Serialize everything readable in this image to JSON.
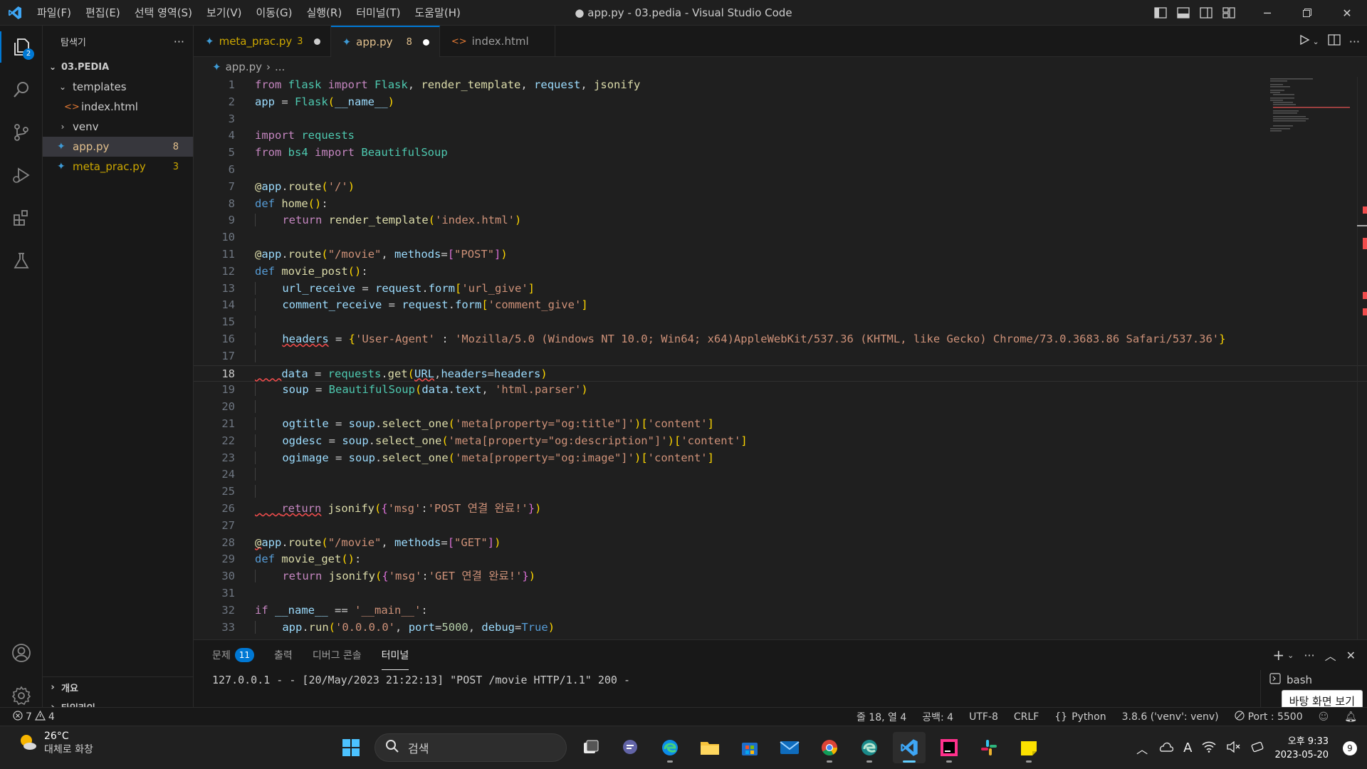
{
  "titlebar": {
    "menu": [
      "파일(F)",
      "편집(E)",
      "선택 영역(S)",
      "보기(V)",
      "이동(G)",
      "실행(R)",
      "터미널(T)",
      "도움말(H)"
    ],
    "title": "● app.py - 03.pedia - Visual Studio Code"
  },
  "activitybar": {
    "explorer_badge": "2"
  },
  "sidebar": {
    "title": "탐색기",
    "more": "···",
    "root": "03.PEDIA",
    "items": [
      {
        "label": "templates",
        "type": "folder-open"
      },
      {
        "label": "index.html",
        "type": "html"
      },
      {
        "label": "venv",
        "type": "folder"
      },
      {
        "label": "app.py",
        "type": "python",
        "count": "8"
      },
      {
        "label": "meta_prac.py",
        "type": "python",
        "count": "3"
      }
    ],
    "outline": "개요",
    "timeline": "타임라인"
  },
  "tabs": [
    {
      "label": "meta_prac.py",
      "count": "3"
    },
    {
      "label": "app.py",
      "count": "8"
    },
    {
      "label": "index.html",
      "count": ""
    }
  ],
  "breadcrumb": {
    "file": "app.py",
    "rest": "..."
  },
  "code": {
    "line_numbers": [
      "1",
      "2",
      "3",
      "4",
      "5",
      "6",
      "7",
      "8",
      "9",
      "10",
      "11",
      "12",
      "13",
      "14",
      "15",
      "16",
      "17",
      "18",
      "19",
      "20",
      "21",
      "22",
      "23",
      "24",
      "25",
      "26",
      "27",
      "28",
      "29",
      "30",
      "31",
      "32",
      "33"
    ],
    "current_line": "18"
  },
  "panel": {
    "tabs": [
      "문제",
      "출력",
      "디버그 콘솔",
      "터미널"
    ],
    "problems_count": "11",
    "terminal_output": "127.0.0.1 - - [20/May/2023 21:22:13] \"POST /movie HTTP/1.1\" 200 -",
    "terminal_name": "bash",
    "tooltip": "바탕 화면 보기"
  },
  "statusbar": {
    "errors": "7",
    "warnings": "4",
    "position": "줄 18, 열 4",
    "spaces": "공백: 4",
    "encoding": "UTF-8",
    "eol": "CRLF",
    "language": "Python",
    "interpreter": "3.8.6 ('venv': venv)",
    "port": "Port : 5500"
  },
  "taskbar": {
    "temperature": "26°C",
    "weather": "대체로 화창",
    "search_placeholder": "검색",
    "time": "오후 9:33",
    "date": "2023-05-20",
    "notifications": "9"
  },
  "colors": {
    "accent": "#0078d4",
    "error": "#f14c4c",
    "modified": "#e2c08d"
  }
}
